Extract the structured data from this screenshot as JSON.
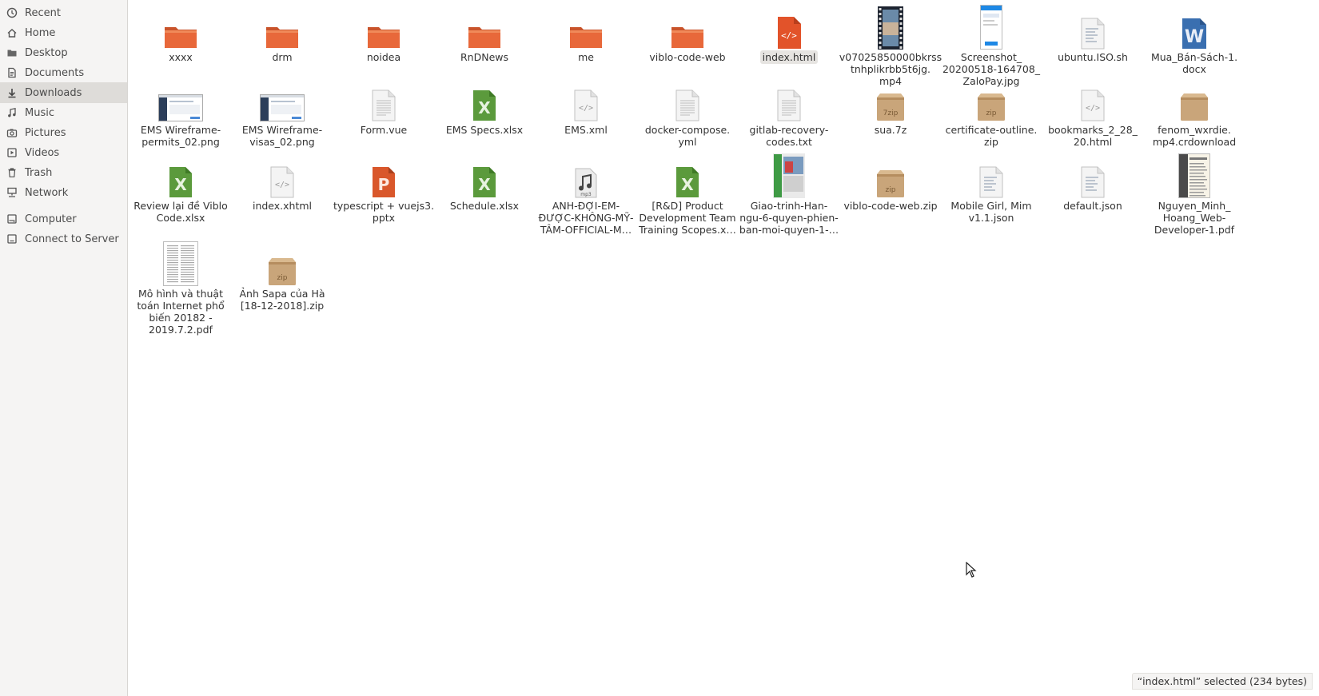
{
  "sidebar": {
    "items": [
      {
        "label": "Recent",
        "icon": "clock-icon"
      },
      {
        "label": "Home",
        "icon": "home-icon"
      },
      {
        "label": "Desktop",
        "icon": "folder-icon"
      },
      {
        "label": "Documents",
        "icon": "document-icon"
      },
      {
        "label": "Downloads",
        "icon": "download-icon",
        "active": true
      },
      {
        "label": "Music",
        "icon": "music-icon"
      },
      {
        "label": "Pictures",
        "icon": "camera-icon"
      },
      {
        "label": "Videos",
        "icon": "video-icon"
      },
      {
        "label": "Trash",
        "icon": "trash-icon"
      },
      {
        "label": "Network",
        "icon": "network-icon"
      },
      {
        "label": "Computer",
        "icon": "drive-icon"
      },
      {
        "label": "Connect to Server",
        "icon": "server-icon"
      }
    ]
  },
  "files": [
    {
      "name": "xxxx",
      "type": "folder"
    },
    {
      "name": "drm",
      "type": "folder"
    },
    {
      "name": "noidea",
      "type": "folder"
    },
    {
      "name": "RnDNews",
      "type": "folder"
    },
    {
      "name": "me",
      "type": "folder"
    },
    {
      "name": "viblo-code-web",
      "type": "folder"
    },
    {
      "name": "index.html",
      "type": "html",
      "selected": true
    },
    {
      "name": "v07025850000bkrsstnhplikrbb5t6jg.mp4",
      "display": "v07025850000bkrss\ntnhplikrbb5t6jg.\nmp4",
      "type": "video"
    },
    {
      "name": "Screenshot_20200518-164708_ZaloPay.jpg",
      "display": "Screenshot_\n20200518-164708_\nZaloPay.jpg",
      "type": "image-phone"
    },
    {
      "name": "ubuntu.ISO.sh",
      "type": "script"
    },
    {
      "name": "Mua_Bán-Sách-1.docx",
      "display": "Mua_Bán-Sách-1.\ndocx",
      "type": "word"
    },
    {
      "name": "EMS Wireframe-permits_02.png",
      "display": "EMS Wireframe-\npermits_02.png",
      "type": "image-screen"
    },
    {
      "name": "EMS Wireframe-visas_02.png",
      "display": "EMS Wireframe-\nvisas_02.png",
      "type": "image-screen"
    },
    {
      "name": "Form.vue",
      "type": "text"
    },
    {
      "name": "EMS Specs.xlsx",
      "type": "excel"
    },
    {
      "name": "EMS.xml",
      "type": "code"
    },
    {
      "name": "docker-compose.yml",
      "display": "docker-compose.\nyml",
      "type": "text"
    },
    {
      "name": "gitlab-recovery-codes.txt",
      "display": "gitlab-recovery-\ncodes.txt",
      "type": "text"
    },
    {
      "name": "sua.7z",
      "type": "7zip"
    },
    {
      "name": "certificate-outline.zip",
      "display": "certificate-outline.\nzip",
      "type": "zip"
    },
    {
      "name": "bookmarks_2_28_20.html",
      "display": "bookmarks_2_28_\n20.html",
      "type": "code"
    },
    {
      "name": "fenom_wxrdie.mp4.crdownload",
      "display": "fenom_wxrdie.\nmp4.crdownload",
      "type": "package"
    },
    {
      "name": "Review lại đề Viblo Code.xlsx",
      "display": "Review lại đề Viblo\nCode.xlsx",
      "type": "excel"
    },
    {
      "name": "index.xhtml",
      "type": "code"
    },
    {
      "name": "typescript + vuejs3.pptx",
      "display": "typescript + vuejs3.\npptx",
      "type": "ppt"
    },
    {
      "name": "Schedule.xlsx",
      "type": "excel"
    },
    {
      "name": "ANH-ĐỢI-EM-ĐƯỢC-KHÔNG-MỸ-TÂM-OFFICIAL-M…",
      "display": "ANH-ĐỢI-EM-\nĐƯỢC-KHÔNG-MỸ-\nTÂM-OFFICIAL-M…",
      "type": "audio"
    },
    {
      "name": "[R&D] Product Development Team Training Scopes.x…",
      "display": "[R&D] Product\nDevelopment Team\nTraining Scopes.x…",
      "type": "excel"
    },
    {
      "name": "Giao-trinh-Han-ngu-6-quyen-phien-ban-moi-quyen-1-…",
      "display": "Giao-trinh-Han-\nngu-6-quyen-phien-\nban-moi-quyen-1-…",
      "type": "book"
    },
    {
      "name": "viblo-code-web.zip",
      "type": "zip"
    },
    {
      "name": "Mobile Girl, Mim v1.1.json",
      "display": "Mobile Girl, Mim\nv1.1.json",
      "type": "script"
    },
    {
      "name": "default.json",
      "type": "script"
    },
    {
      "name": "Nguyen_Minh_Hoang_Web-Developer-1.pdf",
      "display": "Nguyen_Minh_\nHoang_Web-\nDeveloper-1.pdf",
      "type": "pdf-cv"
    },
    {
      "name": "Mô hình và thuật toán Internet phổ biến 20182 - 2019.7.2.pdf",
      "display": "Mô hình và thuật\ntoán Internet phổ\nbiến 20182 -\n2019.7.2.pdf",
      "type": "pdf-doc"
    },
    {
      "name": "Ảnh Sapa của Hà [18-12-2018].zip",
      "display": "Ảnh Sapa của Hà\n[18-12-2018].zip",
      "type": "zip"
    }
  ],
  "status": {
    "text": "“index.html” selected  (234 bytes)"
  },
  "colors": {
    "folder": "#e8683a",
    "excel": "#5b9a3c",
    "ppt": "#d9572b",
    "word": "#3a6fb0",
    "zip": "#c9a57a"
  }
}
